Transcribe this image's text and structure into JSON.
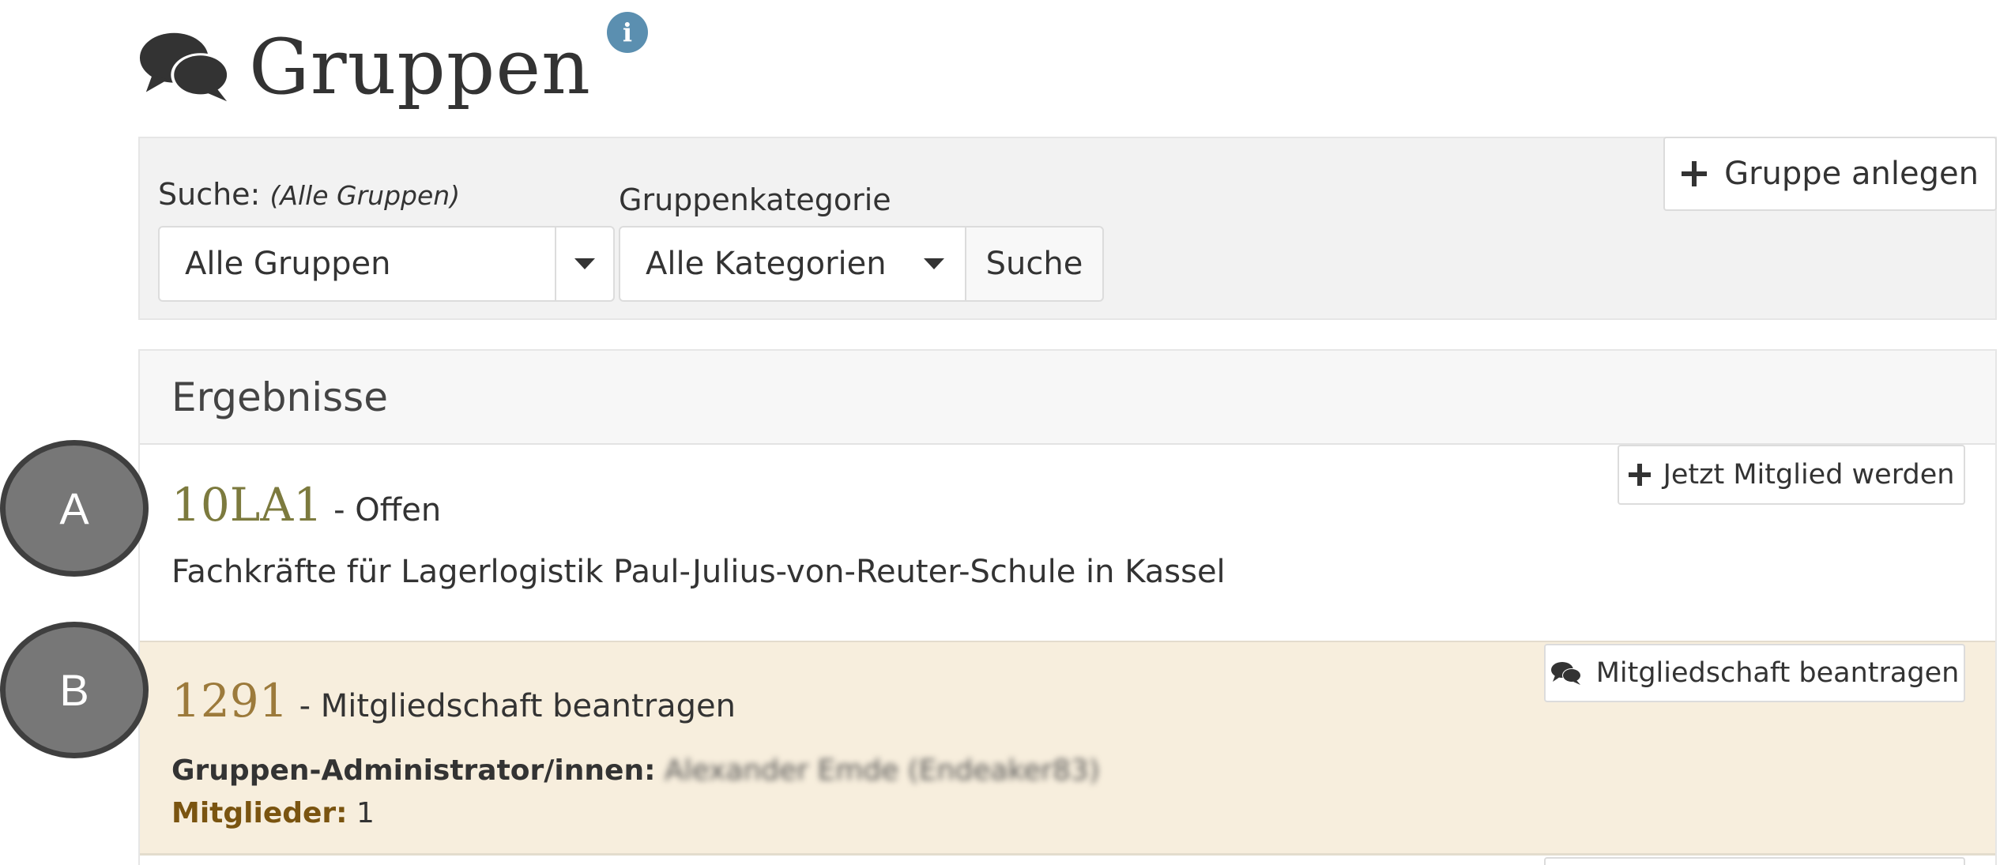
{
  "header": {
    "title": "Gruppen",
    "title_icon": "chat-bubbles-icon",
    "info_icon": "info-icon",
    "info_label": "i"
  },
  "filter": {
    "search_label": "Suche:",
    "search_hint": "(Alle Gruppen)",
    "search_select_value": "Alle Gruppen",
    "category_label": "Gruppenkategorie",
    "category_select_value": "Alle Kategorien",
    "search_button": "Suche",
    "create_button": "Gruppe anlegen"
  },
  "results": {
    "heading": "Ergebnisse",
    "groups": [
      {
        "name": "10LA1",
        "status": "- Offen",
        "description": "Fachkräfte für Lagerlogistik Paul-Julius-von-Reuter-Schule in Kassel",
        "action": "Jetzt Mitglied werden"
      },
      {
        "name": "1291",
        "status": "- Mitgliedschaft beantragen",
        "admins_label": "Gruppen-Administrator/innen:",
        "admins_value": "Alexander Emde (Endeaker83)",
        "members_label": "Mitglieder:",
        "members_value": "1",
        "action": "Mitgliedschaft beantragen"
      }
    ]
  },
  "markers": [
    "A",
    "B"
  ],
  "colors": {
    "group_name_a": "#7c7a3e",
    "group_name_b": "#9c7a3b",
    "row_b_background": "#f7eedd",
    "info_icon": "#5b8fb0",
    "marker": "#777777"
  }
}
